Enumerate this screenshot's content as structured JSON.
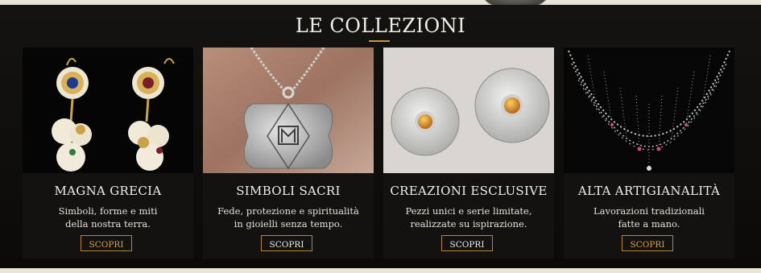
{
  "section": {
    "title": "LE COLLEZIONI"
  },
  "cards": [
    {
      "title": "MAGNA GRECIA",
      "desc_line1": "Simboli, forme e miti",
      "desc_line2": "della nostra terra.",
      "button": "SCOPRI"
    },
    {
      "title": "SIMBOLI SACRI",
      "desc_line1": "Fede, protezione e spiritualità",
      "desc_line2": "in gioielli senza tempo.",
      "button": "SCOPRI"
    },
    {
      "title": "CREAZIONI ESCLUSIVE",
      "desc_line1": "Pezzi unici e serie limitate,",
      "desc_line2": "realizzate su ispirazione.",
      "button": "SCOPRI"
    },
    {
      "title": "ALTA ARTIGIANALITÀ",
      "desc_line1": "Lavorazioni tradizionali",
      "desc_line2": "fatte a mano.",
      "button": "SCOPRI"
    }
  ],
  "colors": {
    "background": "#0e0d0c",
    "accent_gold": "#c9963e",
    "text_light": "#f3eee6"
  }
}
